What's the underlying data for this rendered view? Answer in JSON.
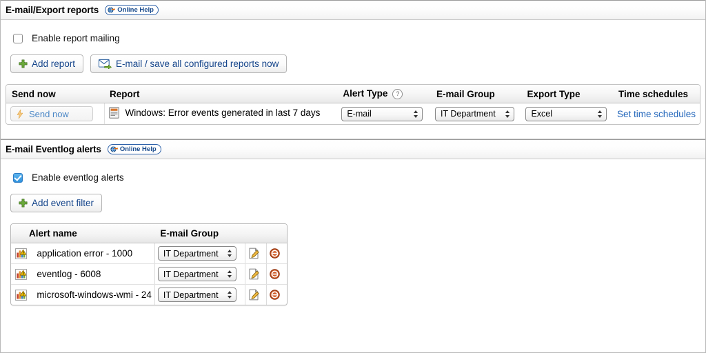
{
  "sections": [
    {
      "id": "email-export-reports",
      "title": "E-mail/Export reports",
      "help_label": "Online Help",
      "help_icon": "globe-arrow-icon",
      "enable_checkbox": {
        "label": "Enable report mailing",
        "checked": false
      },
      "buttons": [
        {
          "id": "add-report",
          "label": "Add report",
          "icon": "green-plus-icon"
        },
        {
          "id": "email-save-all",
          "label": "E-mail / save all configured reports now",
          "icon": "envelope-arrow-icon"
        }
      ],
      "table": {
        "headers": [
          "Send now",
          "Report",
          "Alert Type",
          "E-mail Group",
          "Export Type",
          "Time schedules"
        ],
        "alert_type_help_icon": "question-mark-icon",
        "rows": [
          {
            "send_now_label": "Send now",
            "send_now_icon": "lightning-bolt-icon",
            "report_icon": "report-document-icon",
            "report_name": "Windows: Error events generated in last 7 days",
            "alert_type": "E-mail",
            "email_group": "IT Department",
            "export_type": "Excel",
            "time_schedules_link": "Set time schedules"
          }
        ]
      }
    },
    {
      "id": "email-eventlog-alerts",
      "title": "E-mail Eventlog alerts",
      "help_label": "Online Help",
      "help_icon": "globe-arrow-icon",
      "enable_checkbox": {
        "label": "Enable eventlog alerts",
        "checked": true
      },
      "buttons": [
        {
          "id": "add-event-filter",
          "label": "Add event filter",
          "icon": "green-plus-icon"
        }
      ],
      "table": {
        "headers": [
          "Alert name",
          "E-mail Group"
        ],
        "rows": [
          {
            "icon": "bar-chart-warning-icon",
            "alert_name": "application error - 1000",
            "email_group": "IT Department",
            "edit_icon": "edit-pencil-icon",
            "delete_icon": "delete-minus-icon"
          },
          {
            "icon": "bar-chart-warning-icon",
            "alert_name": "eventlog - 6008",
            "email_group": "IT Department",
            "edit_icon": "edit-pencil-icon",
            "delete_icon": "delete-minus-icon"
          },
          {
            "icon": "bar-chart-warning-icon",
            "alert_name": "microsoft-windows-wmi - 24",
            "email_group": "IT Department",
            "edit_icon": "edit-pencil-icon",
            "delete_icon": "delete-minus-icon"
          }
        ]
      }
    }
  ],
  "colors": {
    "link": "#2266bb",
    "help_border": "#2b5fa8",
    "help_text": "#184a8c",
    "checkbox_checked": "#2e91dd",
    "delete": "#c0471a",
    "button_text": "#14448a"
  }
}
